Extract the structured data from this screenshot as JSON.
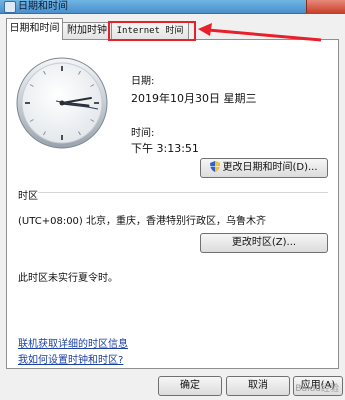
{
  "window": {
    "title": "日期和时间"
  },
  "tabs": [
    {
      "label": "日期和时间"
    },
    {
      "label": "附加时钟"
    },
    {
      "label": "Internet 时间"
    }
  ],
  "datetime": {
    "date_label": "日期:",
    "date_value": "2019年10月30日 星期三",
    "time_label": "时间:",
    "time_value": "下午 3:13:51",
    "change_button": "更改日期和时间(D)..."
  },
  "timezone": {
    "section_label": "时区",
    "value": "(UTC+08:00) 北京，重庆，香港特别行政区，乌鲁木齐",
    "change_button": "更改时区(Z)...",
    "dst_note": "此时区未实行夏令时。"
  },
  "links": {
    "online_info": "联机获取详细的时区信息",
    "how_to_set": "我如何设置时钟和时区?"
  },
  "footer": {
    "ok": "确定",
    "cancel": "取消",
    "apply": "应用(A)"
  },
  "annotation": {
    "color": "#e8202a"
  },
  "watermark": "Baidu经验"
}
